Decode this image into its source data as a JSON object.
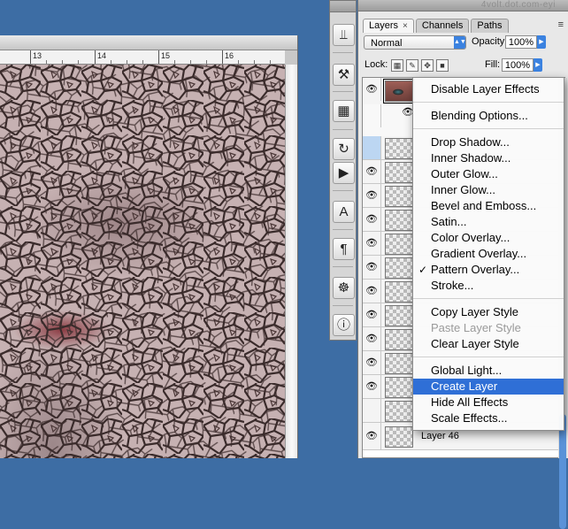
{
  "ruler": {
    "labels": [
      "13",
      "14",
      "15",
      "16"
    ]
  },
  "panel": {
    "watermark": "4volt.dot.com-eyi",
    "tabs": [
      {
        "label": "Layers",
        "close": "×"
      },
      {
        "label": "Channels"
      },
      {
        "label": "Paths"
      }
    ],
    "menu_glyph": "≡",
    "blend_mode": "Normal",
    "opacity_label": "Opacity:",
    "opacity_value": "100%",
    "lock_label": "Lock:",
    "fill_label": "Fill:",
    "fill_value": "100%",
    "eye_glyph": "👁",
    "last_layer_name": "Layer 46"
  },
  "context_menu": {
    "groups": [
      [
        "Disable Layer Effects"
      ],
      [
        "Blending Options..."
      ],
      [
        "Drop Shadow...",
        "Inner Shadow...",
        "Outer Glow...",
        "Inner Glow...",
        "Bevel and Emboss...",
        "Satin...",
        "Color Overlay...",
        "Gradient Overlay...",
        "Pattern Overlay...",
        "Stroke..."
      ],
      [
        "Copy Layer Style",
        "Paste Layer Style",
        "Clear Layer Style"
      ],
      [
        "Global Light...",
        "Create Layer",
        "Hide All Effects",
        "Scale Effects..."
      ]
    ],
    "checked": "Pattern Overlay...",
    "disabled": "Paste Layer Style",
    "highlighted": "Create Layer",
    "check_glyph": "✓"
  },
  "colors": {
    "desktop": "#3d6da4",
    "highlight": "#2f6fd6",
    "accent": "#3b82e0"
  },
  "tools": {
    "icons": [
      "usb-icon",
      "tools-icon",
      "grid-icon",
      "actions-icon",
      "play-icon",
      "text-icon",
      "paragraph-icon",
      "navigator-icon",
      "info-icon"
    ],
    "glyphs": [
      "⫫",
      "⚒",
      "▦",
      "↻",
      "▶",
      "A",
      "¶",
      "☸",
      "ⓘ"
    ]
  }
}
